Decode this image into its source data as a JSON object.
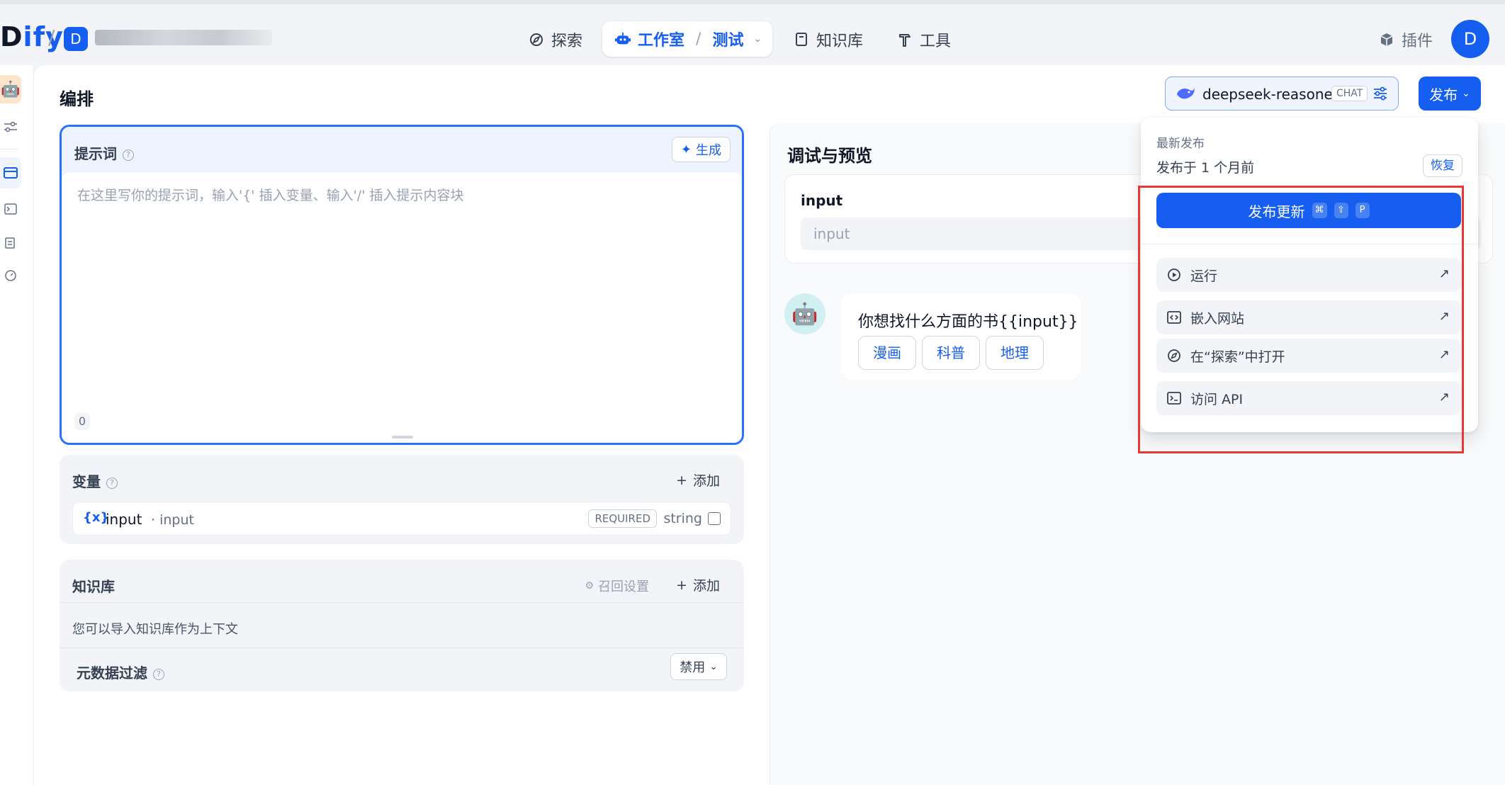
{
  "app": {
    "logo_prefix": "D",
    "logo_rest": "ify",
    "workspace_initial": "D"
  },
  "nav": {
    "explore": "探索",
    "studio": "工作室",
    "studio_app": "测试",
    "knowledge": "知识库",
    "tools": "工具",
    "plugins": "插件",
    "user_initial": "D"
  },
  "page": {
    "title": "编排"
  },
  "prompt": {
    "label": "提示词",
    "generate": "生成",
    "placeholder": "在这里写你的提示词，输入'{' 插入变量、输入'/' 插入提示内容块",
    "count": "0"
  },
  "variables": {
    "title": "变量",
    "add": "添加",
    "items": [
      {
        "icon": "{x}",
        "name": "input",
        "label": "input",
        "badge": "REQUIRED",
        "type": "string"
      }
    ]
  },
  "knowledge": {
    "title": "知识库",
    "recall": "召回设置",
    "add": "添加",
    "description": "您可以导入知识库作为上下文",
    "metadata_filter": "元数据过滤",
    "metadata_value": "禁用"
  },
  "debug": {
    "title": "调试与预览",
    "input_label": "input",
    "input_placeholder": "input",
    "message": "你想找什么方面的书{{input}}",
    "suggestions": [
      "漫画",
      "科普",
      "地理"
    ]
  },
  "model": {
    "name": "deepseek-reasoner",
    "mode_badge": "CHAT"
  },
  "publish": {
    "label": "发布",
    "dropdown": {
      "latest": "最新发布",
      "published_time": "发布于 1 个月前",
      "restore": "恢复",
      "update": "发布更新",
      "shortcut": [
        "⌘",
        "⇧",
        "P"
      ],
      "items": [
        {
          "icon": "play-circle-icon",
          "label": "运行"
        },
        {
          "icon": "embed-icon",
          "label": "嵌入网站"
        },
        {
          "icon": "compass-icon",
          "label": "在“探索”中打开"
        },
        {
          "icon": "terminal-icon",
          "label": "访问 API"
        }
      ]
    }
  },
  "colors": {
    "primary": "#155eef",
    "highlight_box": "#e53935"
  }
}
